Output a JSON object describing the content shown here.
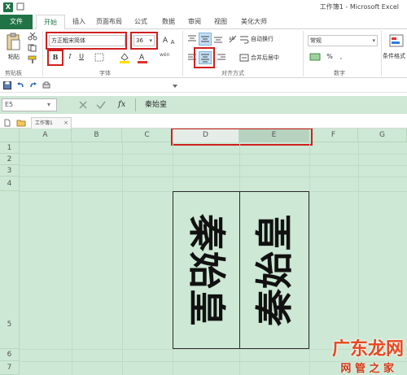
{
  "window": {
    "title": "工作簿1 - Microsoft Excel",
    "app_icon": "X"
  },
  "tabs": [
    "文件",
    "开始",
    "插入",
    "页面布局",
    "公式",
    "数据",
    "审阅",
    "视图",
    "美化大师"
  ],
  "ribbon": {
    "clipboard": {
      "paste_label": "粘贴",
      "group_label": "剪贴板"
    },
    "font": {
      "font_name": "方正粗宋简体",
      "font_size": "36",
      "bold": "B",
      "italic": "I",
      "underline": "U",
      "font_color_letter": "A",
      "group_label": "字体",
      "phonetic": "wén"
    },
    "alignment": {
      "wrap_text": "自动换行",
      "merge_center": "合并后居中",
      "group_label": "对齐方式"
    },
    "number": {
      "format": "常规",
      "currency": "%",
      "comma": ",",
      "group_label": "数字"
    },
    "styles": {
      "conditional_format": "条件格式"
    }
  },
  "formula_bar": {
    "name_box": "E5",
    "fx": "fx",
    "content": "秦始皇"
  },
  "workbook_tab": "工作簿1",
  "sheet": {
    "columns": [
      "A",
      "B",
      "C",
      "D",
      "E",
      "F",
      "G"
    ],
    "rows": [
      "1",
      "2",
      "3",
      "4",
      "5",
      "6",
      "7"
    ],
    "cells": {
      "D5": "秦始皇",
      "E5": "秦始皇"
    }
  },
  "watermark": {
    "main": "广东龙网",
    "sub": "网 管 之 家"
  },
  "colors": {
    "excel_green": "#217346",
    "highlight_red": "#d02020",
    "sheet_bg": "#cde8d4",
    "font_color_red": "#e03030",
    "fill_yellow": "#ffe000"
  }
}
